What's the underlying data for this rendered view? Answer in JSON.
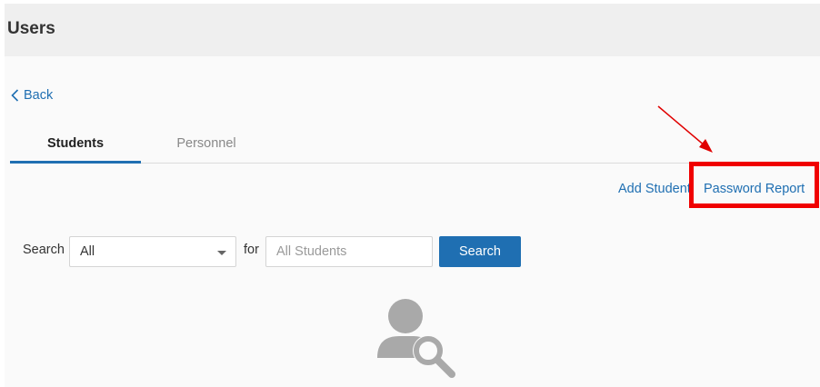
{
  "header": {
    "title": "Users"
  },
  "nav": {
    "back_label": "Back"
  },
  "tabs": [
    {
      "label": "Students",
      "active": true
    },
    {
      "label": "Personnel",
      "active": false
    }
  ],
  "actions": {
    "add_student_label": "Add Student",
    "password_report_label": "Password Report"
  },
  "search": {
    "label": "Search",
    "filter_selected": "All",
    "for_label": "for",
    "placeholder": "All Students",
    "value": "",
    "button_label": "Search"
  },
  "empty_state": {
    "icon": "user-search-icon"
  },
  "annotation": {
    "color": "#e00000"
  },
  "colors": {
    "accent": "#1f6fb2",
    "header_bg": "#efefef",
    "highlight": "#f00000"
  }
}
